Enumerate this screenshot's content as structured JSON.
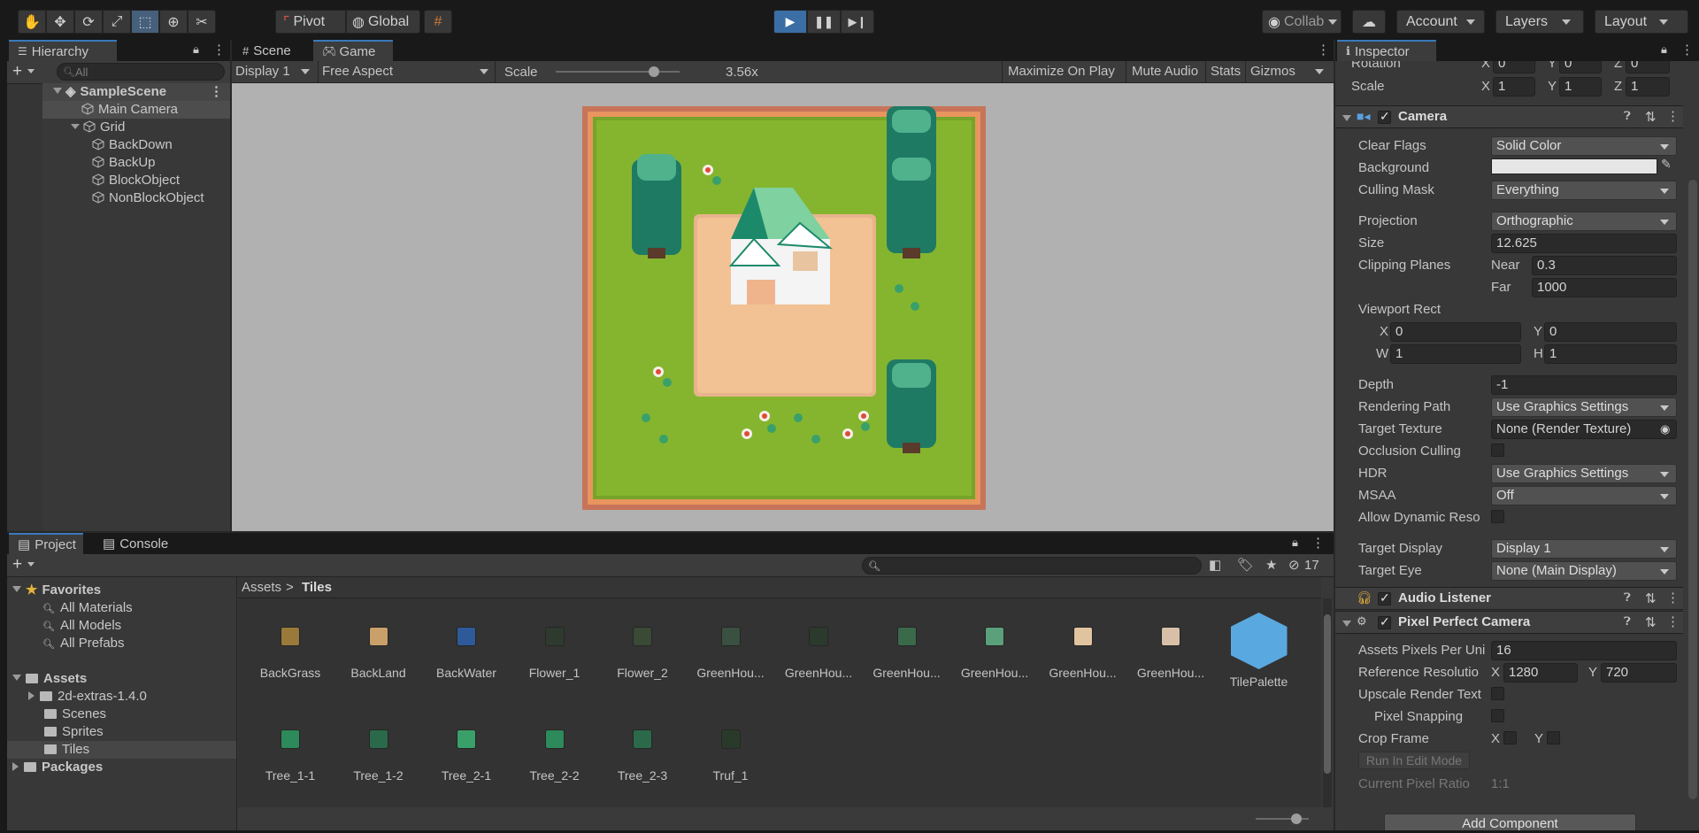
{
  "toolbar": {
    "pivot": "Pivot",
    "global": "Global",
    "collab": "Collab",
    "account": "Account",
    "layers": "Layers",
    "layout": "Layout"
  },
  "hierarchy": {
    "tab": "Hierarchy",
    "search_placeholder": "All",
    "scene": "SampleScene",
    "items": [
      "Main Camera",
      "Grid",
      "BackDown",
      "BackUp",
      "BlockObject",
      "NonBlockObject"
    ]
  },
  "scene_tabs": {
    "scene": "Scene",
    "game": "Game"
  },
  "game_bar": {
    "display": "Display 1",
    "aspect": "Free Aspect",
    "scale_label": "Scale",
    "scale_value": "3.56x",
    "scale_fraction": 0.79,
    "maximize": "Maximize On Play",
    "mute": "Mute Audio",
    "stats": "Stats",
    "gizmos": "Gizmos"
  },
  "project": {
    "tab_project": "Project",
    "tab_console": "Console",
    "hidden_count": "17",
    "breadcrumb_root": "Assets",
    "breadcrumb_current": "Tiles",
    "favorites": {
      "label": "Favorites",
      "items": [
        "All Materials",
        "All Models",
        "All Prefabs"
      ]
    },
    "assets": {
      "label": "Assets",
      "items": [
        "2d-extras-1.4.0",
        "Scenes",
        "Sprites",
        "Tiles"
      ]
    },
    "packages": "Packages",
    "files_row1": [
      "BackGrass",
      "BackLand",
      "BackWater",
      "Flower_1",
      "Flower_2",
      "GreenHou...",
      "GreenHou...",
      "GreenHou...",
      "GreenHou...",
      "GreenHou...",
      "GreenHou...",
      "TilePalette"
    ],
    "files_row2": [
      "Tree_1-1",
      "Tree_1-2",
      "Tree_2-1",
      "Tree_2-2",
      "Tree_2-3",
      "Truf_1"
    ],
    "thumb_colors": [
      "#9a7a3a",
      "#c9a06a",
      "#2e5a9a",
      "#2f3a2f",
      "#3a4a35",
      "#3a5040",
      "#2c3a2e",
      "#3a6a4a",
      "#5aa07a",
      "#e0c4a0",
      "#d8c0a8",
      "#2d8a5a",
      "#2a6a4a",
      "#3aa06a",
      "#2d8a5a",
      "#2a6a4a",
      "#2a3a2a"
    ]
  },
  "inspector": {
    "tab": "Inspector",
    "rotation": {
      "label": "Rotation",
      "x": "0",
      "y": "0",
      "z": "0"
    },
    "scale": {
      "label": "Scale",
      "x": "1",
      "y": "1",
      "z": "1"
    },
    "camera": {
      "title": "Camera",
      "clear_flags": {
        "label": "Clear Flags",
        "value": "Solid Color"
      },
      "background": {
        "label": "Background",
        "color": "#e6e6e6"
      },
      "culling_mask": {
        "label": "Culling Mask",
        "value": "Everything"
      },
      "projection": {
        "label": "Projection",
        "value": "Orthographic"
      },
      "size": {
        "label": "Size",
        "value": "12.625"
      },
      "clipping": {
        "label": "Clipping Planes",
        "near_label": "Near",
        "near": "0.3",
        "far_label": "Far",
        "far": "1000"
      },
      "viewport": {
        "label": "Viewport Rect",
        "x": "0",
        "y": "0",
        "w": "1",
        "h": "1"
      },
      "depth": {
        "label": "Depth",
        "value": "-1"
      },
      "rendering_path": {
        "label": "Rendering Path",
        "value": "Use Graphics Settings"
      },
      "target_texture": {
        "label": "Target Texture",
        "value": "None (Render Texture)"
      },
      "occlusion": {
        "label": "Occlusion Culling"
      },
      "hdr": {
        "label": "HDR",
        "value": "Use Graphics Settings"
      },
      "msaa": {
        "label": "MSAA",
        "value": "Off"
      },
      "dynamic_res": {
        "label": "Allow Dynamic Reso"
      },
      "target_display": {
        "label": "Target Display",
        "value": "Display 1"
      },
      "target_eye": {
        "label": "Target Eye",
        "value": "None (Main Display)"
      }
    },
    "audio_listener": {
      "title": "Audio Listener"
    },
    "ppc": {
      "title": "Pixel Perfect Camera",
      "assets_ppu": {
        "label": "Assets Pixels Per Uni",
        "value": "16"
      },
      "ref_res": {
        "label": "Reference Resolutio",
        "x": "1280",
        "y": "720"
      },
      "upscale": {
        "label": "Upscale Render Text"
      },
      "snapping": {
        "label": "Pixel Snapping"
      },
      "crop": {
        "label": "Crop Frame"
      },
      "run_edit": "Run In Edit Mode",
      "ratio": {
        "label": "Current Pixel Ratio",
        "value": "1:1"
      }
    },
    "add_component": "Add Component"
  }
}
